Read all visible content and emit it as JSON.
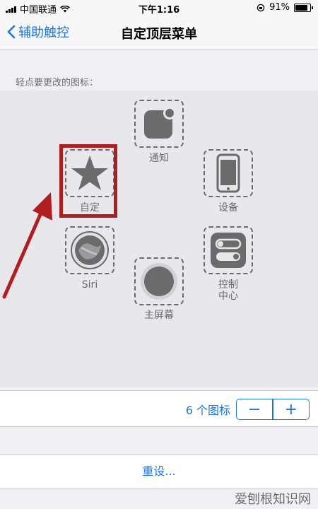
{
  "status_bar": {
    "carrier": "中国联通",
    "time": "下午1:16",
    "battery": "91%",
    "battery_level": 0.91
  },
  "nav": {
    "back_label": "辅助触控",
    "title": "自定顶层菜单"
  },
  "hint": "轻点要更改的图标：",
  "icons": [
    {
      "name": "通知",
      "icon": "notification-icon"
    },
    {
      "name": "设备",
      "icon": "device-icon"
    },
    {
      "name": "控制\n中心",
      "icon": "control-center-icon"
    },
    {
      "name": "主屏幕",
      "icon": "home-button-icon"
    },
    {
      "name": "Siri",
      "icon": "siri-icon"
    },
    {
      "name": "自定",
      "icon": "star-icon"
    }
  ],
  "footer": {
    "count_label": "6 个图标",
    "minus": "−",
    "plus": "+",
    "reset_label": "重设..."
  },
  "watermark": "爱刨根知识网",
  "colors": {
    "accent": "#1a73e8",
    "highlight": "#b01e20",
    "icon_gray": "#6b6b6b"
  }
}
